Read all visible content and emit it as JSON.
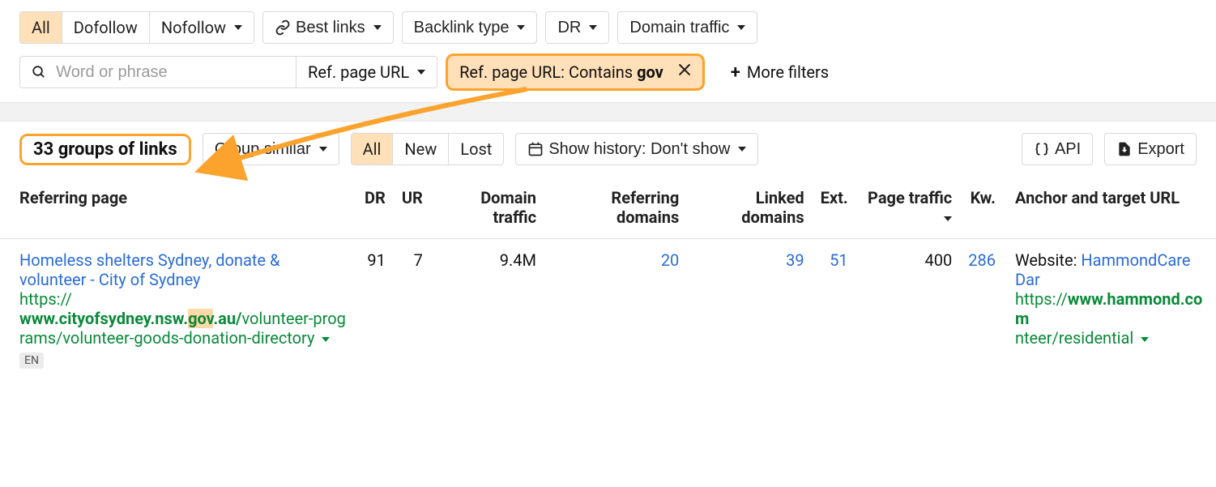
{
  "filters_top": {
    "follow_seg": [
      "All",
      "Dofollow",
      "Nofollow"
    ],
    "follow_active": 0,
    "best_links": "Best links",
    "backlink_type": "Backlink type",
    "dr": "DR",
    "domain_traffic": "Domain traffic"
  },
  "filters_second": {
    "search_placeholder": "Word or phrase",
    "search_scope": "Ref. page URL",
    "chip_prefix": "Ref. page URL: Contains ",
    "chip_value": "gov",
    "more_filters": "More filters"
  },
  "summary": {
    "groups_label": "33 groups of links",
    "group_similar": "Group similar",
    "status_seg": [
      "All",
      "New",
      "Lost"
    ],
    "status_active": 0,
    "history_label": "Show history: Don't show",
    "api": "API",
    "export": "Export"
  },
  "columns": {
    "referring_page": "Referring page",
    "dr": "DR",
    "ur": "UR",
    "domain_traffic": "Domain traffic",
    "referring_domains": "Referring domains",
    "linked_domains": "Linked domains",
    "ext": "Ext.",
    "page_traffic": "Page traffic",
    "kw": "Kw.",
    "anchor": "Anchor and target URL"
  },
  "rows": [
    {
      "title": "Homeless shelters Sydney, donate & volunteer - City of Sydney",
      "url_pre": "https://",
      "url_bold_pre": "www.cityofsydney.nsw.",
      "url_highlight": "gov",
      "url_bold_post": ".au/",
      "url_tail": "volunteer-programs/volunteer-goods-donation-directory",
      "lang": "EN",
      "dr": "91",
      "ur": "7",
      "domain_traffic": "9.4M",
      "referring_domains": "20",
      "linked_domains": "39",
      "ext": "51",
      "page_traffic": "400",
      "kw": "286",
      "anchor_prefix": "Website: ",
      "anchor_link": "HammondCare Dar",
      "target_url_bold": "www.hammond.com",
      "target_url_pre": "https://",
      "target_url_tail": "nteer/residential"
    }
  ]
}
